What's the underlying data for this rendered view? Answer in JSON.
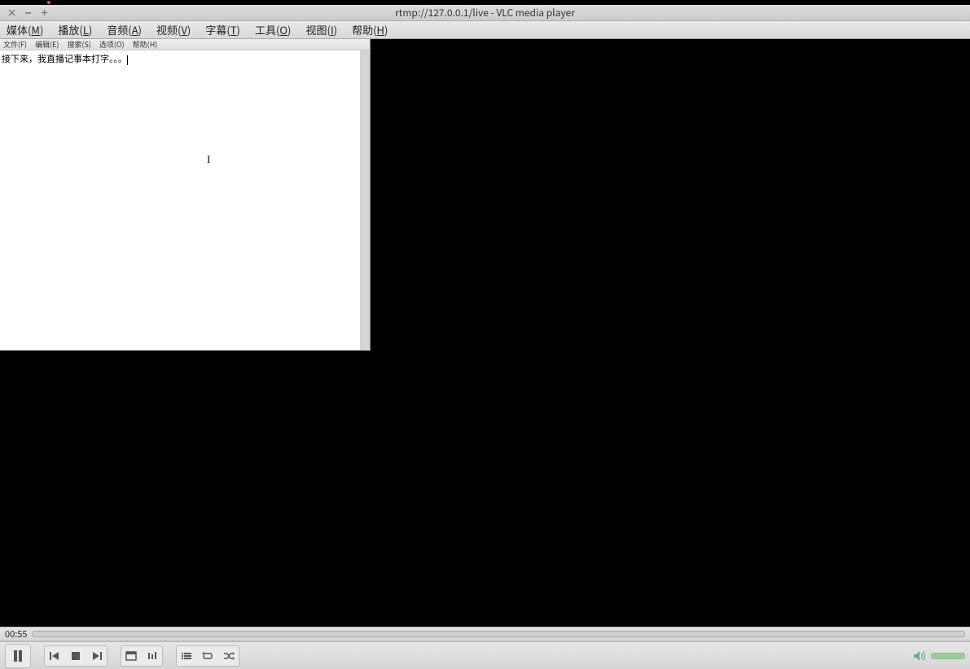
{
  "window": {
    "title": "rtmp://127.0.0.1/live - VLC media player"
  },
  "vlc_menu": [
    {
      "label": "媒体",
      "accel": "M"
    },
    {
      "label": "播放",
      "accel": "L"
    },
    {
      "label": "音频",
      "accel": "A"
    },
    {
      "label": "视频",
      "accel": "V"
    },
    {
      "label": "字幕",
      "accel": "T"
    },
    {
      "label": "工具",
      "accel": "O"
    },
    {
      "label": "视图",
      "accel": "I"
    },
    {
      "label": "帮助",
      "accel": "H"
    }
  ],
  "notepad": {
    "menu": [
      {
        "label": "文件(F)"
      },
      {
        "label": "编辑(E)"
      },
      {
        "label": "搜索(S)"
      },
      {
        "label": "选项(O)"
      },
      {
        "label": "帮助(H)"
      }
    ],
    "content": "接下来，我直播记事本打字。。。"
  },
  "playback": {
    "elapsed": "00:55"
  },
  "controls": {
    "play": "pause-icon",
    "prev": "previous-icon",
    "stop": "stop-icon",
    "next": "next-icon",
    "fullscreen": "fullscreen-icon",
    "settings": "equalizer-icon",
    "playlist": "playlist-icon",
    "loop": "loop-icon",
    "shuffle": "shuffle-icon"
  }
}
